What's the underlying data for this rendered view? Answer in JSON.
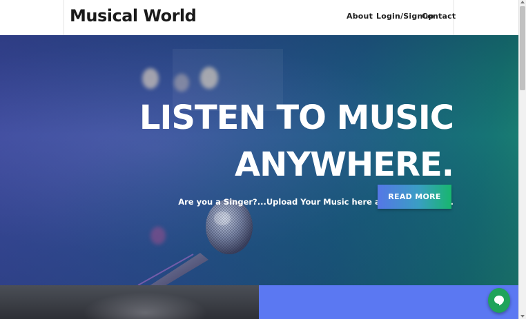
{
  "header": {
    "brand": "Musical World",
    "nav": {
      "about": "About",
      "login": "Login/Signup",
      "contact": "Contact"
    }
  },
  "hero": {
    "headline_line1": "LISTEN TO MUSIC",
    "headline_line2": "ANYWHERE.",
    "subline": "Are you a Singer?...Upload Your Music here and get featured.",
    "cta_label": "READ MORE"
  },
  "icons": {
    "chat": "chat-bubble-icon",
    "scroll_up": "arrow-up-icon",
    "scroll_down": "arrow-down-icon"
  },
  "colors": {
    "cta_gradient_start": "#5577e6",
    "cta_gradient_end": "#18b66e",
    "bottom_right_panel": "#5b78f2",
    "chat_button": "#1fa35a"
  }
}
